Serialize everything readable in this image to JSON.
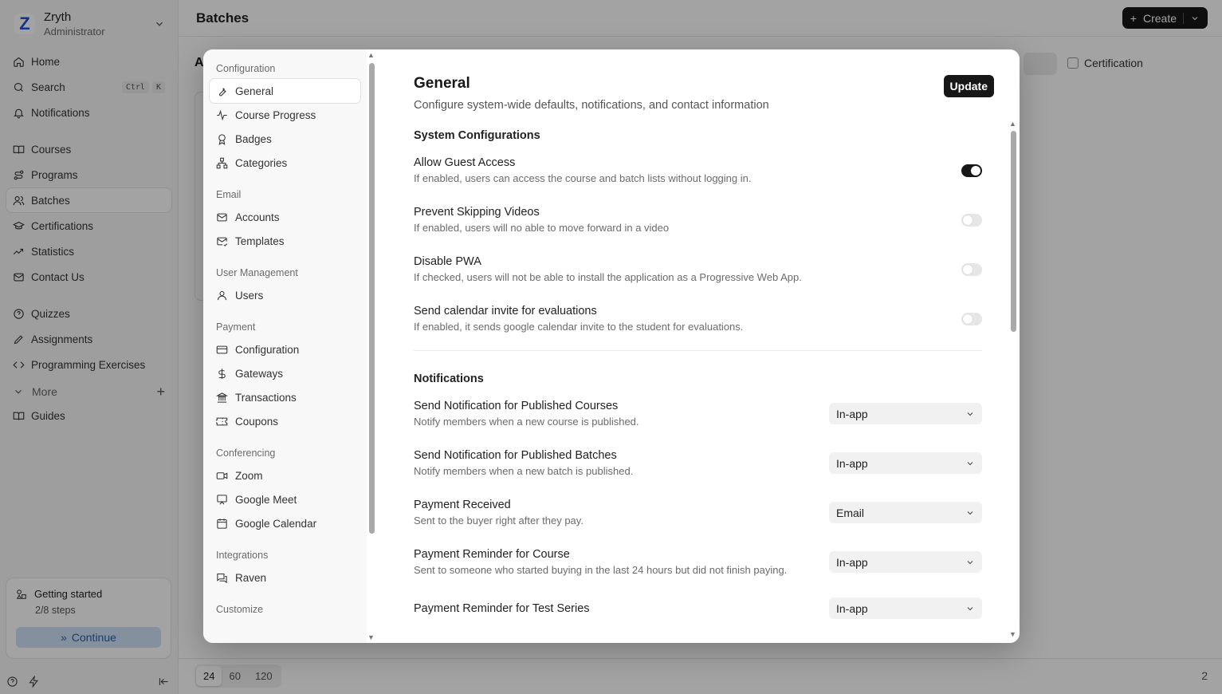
{
  "brand": {
    "logo_letter": "Z",
    "name": "Zryth",
    "role": "Administrator"
  },
  "sidebar": {
    "group1": [
      {
        "label": "Home",
        "icon": "home-icon"
      },
      {
        "label": "Search",
        "icon": "search-icon",
        "kbd": [
          "Ctrl",
          "K"
        ]
      },
      {
        "label": "Notifications",
        "icon": "bell-icon"
      }
    ],
    "group2": [
      {
        "label": "Courses",
        "icon": "book-icon"
      },
      {
        "label": "Programs",
        "icon": "route-icon"
      },
      {
        "label": "Batches",
        "icon": "users-icon",
        "active": true
      },
      {
        "label": "Certifications",
        "icon": "graduation-cap-icon"
      },
      {
        "label": "Statistics",
        "icon": "trend-icon"
      },
      {
        "label": "Contact Us",
        "icon": "mail-icon"
      }
    ],
    "group3": [
      {
        "label": "Quizzes",
        "icon": "help-circle-icon"
      },
      {
        "label": "Assignments",
        "icon": "pencil-icon"
      },
      {
        "label": "Programming Exercises",
        "icon": "code-icon"
      }
    ],
    "more_label": "More",
    "guides_label": "Guides",
    "getting_started": {
      "title": "Getting started",
      "steps": "2/8 steps",
      "continue_label": "Continue"
    }
  },
  "topbar": {
    "title": "Batches",
    "create_label": "Create"
  },
  "background": {
    "letter": "A",
    "certification_label": "Certification",
    "page_sizes": [
      "24",
      "60",
      "120"
    ],
    "page_count": "2"
  },
  "settings_nav": {
    "sections": [
      {
        "title": "Configuration",
        "items": [
          {
            "label": "General",
            "icon": "wrench-icon",
            "active": true
          },
          {
            "label": "Course Progress",
            "icon": "activity-icon"
          },
          {
            "label": "Badges",
            "icon": "award-icon"
          },
          {
            "label": "Categories",
            "icon": "network-icon"
          }
        ]
      },
      {
        "title": "Email",
        "items": [
          {
            "label": "Accounts",
            "icon": "mail-icon"
          },
          {
            "label": "Templates",
            "icon": "mail-check-icon"
          }
        ]
      },
      {
        "title": "User Management",
        "items": [
          {
            "label": "Users",
            "icon": "user-icon"
          }
        ]
      },
      {
        "title": "Payment",
        "items": [
          {
            "label": "Configuration",
            "icon": "credit-card-icon"
          },
          {
            "label": "Gateways",
            "icon": "dollar-icon"
          },
          {
            "label": "Transactions",
            "icon": "bank-icon"
          },
          {
            "label": "Coupons",
            "icon": "ticket-icon"
          }
        ]
      },
      {
        "title": "Conferencing",
        "items": [
          {
            "label": "Zoom",
            "icon": "video-icon"
          },
          {
            "label": "Google Meet",
            "icon": "presentation-icon"
          },
          {
            "label": "Google Calendar",
            "icon": "calendar-icon"
          }
        ]
      },
      {
        "title": "Integrations",
        "items": [
          {
            "label": "Raven",
            "icon": "messages-icon"
          }
        ]
      },
      {
        "title": "Customize",
        "items": []
      }
    ]
  },
  "general": {
    "title": "General",
    "subtitle": "Configure system-wide defaults, notifications, and contact information",
    "update_label": "Update",
    "system_title": "System Configurations",
    "toggles": [
      {
        "label": "Allow Guest Access",
        "desc": "If enabled, users can access the course and batch lists without logging in.",
        "on": true
      },
      {
        "label": "Prevent Skipping Videos",
        "desc": "If enabled, users will no able to move forward in a video",
        "on": false
      },
      {
        "label": "Disable PWA",
        "desc": "If checked, users will not be able to install the application as a Progressive Web App.",
        "on": false
      },
      {
        "label": "Send calendar invite for evaluations",
        "desc": "If enabled, it sends google calendar invite to the student for evaluations.",
        "on": false
      }
    ],
    "notifications_title": "Notifications",
    "notifications": [
      {
        "label": "Send Notification for Published Courses",
        "desc": "Notify members when a new course is published.",
        "value": "In-app"
      },
      {
        "label": "Send Notification for Published Batches",
        "desc": "Notify members when a new batch is published.",
        "value": "In-app"
      },
      {
        "label": "Payment Received",
        "desc": "Sent to the buyer right after they pay.",
        "value": "Email"
      },
      {
        "label": "Payment Reminder for Course",
        "desc": "Sent to someone who started buying in the last 24 hours but did not finish paying.",
        "value": "In-app"
      },
      {
        "label": "Payment Reminder for Test Series",
        "desc": "",
        "value": "In-app"
      }
    ]
  }
}
